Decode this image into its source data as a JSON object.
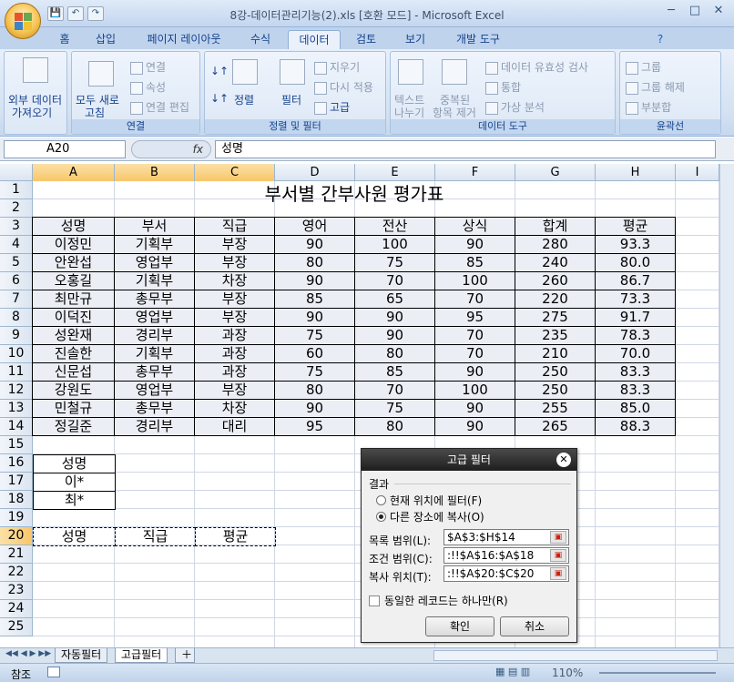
{
  "window": {
    "title": "8강-데이터관리기능(2).xls  [호환 모드] - Microsoft Excel",
    "minimize": "─",
    "maximize": "□",
    "close": "✕"
  },
  "qat": {
    "save": "💾",
    "undo": "↶",
    "redo": "↷"
  },
  "tabs": [
    "홈",
    "삽입",
    "페이지 레이아웃",
    "수식",
    "데이터",
    "검토",
    "보기",
    "개발 도구"
  ],
  "active_tab": "데이터",
  "ribbon": {
    "external": {
      "label1": "외부 데이터",
      "label2": "가져오기"
    },
    "connections": {
      "refresh1": "모두 새로",
      "refresh2": "고침",
      "conn": "연결",
      "props": "속성",
      "edit_links": "연결 편집",
      "group": "연결"
    },
    "sort_filter": {
      "sort": "정렬",
      "filter": "필터",
      "clear": "지우기",
      "reapply": "다시 적용",
      "advanced": "고급",
      "group": "정렬 및 필터"
    },
    "data_tools": {
      "text1": "텍스트",
      "text2": "나누기",
      "dup1": "중복된",
      "dup2": "항목 제거",
      "validation": "데이터 유효성 검사",
      "consolidate": "통합",
      "whatif": "가상 분석",
      "group": "데이터 도구"
    },
    "outline": {
      "group_btn": "그룹",
      "ungroup": "그룹 해제",
      "subtotal": "부분합",
      "group": "윤곽선"
    }
  },
  "formula_bar": {
    "name_box": "A20",
    "fx": "fx",
    "content": "성명"
  },
  "columns": [
    "A",
    "B",
    "C",
    "D",
    "E",
    "F",
    "G",
    "H",
    "I"
  ],
  "rows": [
    "1",
    "2",
    "3",
    "4",
    "5",
    "6",
    "7",
    "8",
    "9",
    "10",
    "11",
    "12",
    "13",
    "14",
    "15",
    "16",
    "17",
    "18",
    "19",
    "20",
    "21",
    "22",
    "23",
    "24",
    "25"
  ],
  "sheet": {
    "title": "부서별 간부사원 평가표",
    "headers": [
      "성명",
      "부서",
      "직급",
      "영어",
      "전산",
      "상식",
      "합계",
      "평균"
    ],
    "rows": [
      [
        "이정민",
        "기획부",
        "부장",
        "90",
        "100",
        "90",
        "280",
        "93.3"
      ],
      [
        "안완섭",
        "영업부",
        "부장",
        "80",
        "75",
        "85",
        "240",
        "80.0"
      ],
      [
        "오홍길",
        "기획부",
        "차장",
        "90",
        "70",
        "100",
        "260",
        "86.7"
      ],
      [
        "최만규",
        "총무부",
        "부장",
        "85",
        "65",
        "70",
        "220",
        "73.3"
      ],
      [
        "이덕진",
        "영업부",
        "부장",
        "90",
        "90",
        "95",
        "275",
        "91.7"
      ],
      [
        "성완재",
        "경리부",
        "과장",
        "75",
        "90",
        "70",
        "235",
        "78.3"
      ],
      [
        "진솔한",
        "기획부",
        "과장",
        "60",
        "80",
        "70",
        "210",
        "70.0"
      ],
      [
        "신문섭",
        "총무부",
        "과장",
        "75",
        "85",
        "90",
        "250",
        "83.3"
      ],
      [
        "강원도",
        "영업부",
        "부장",
        "80",
        "70",
        "100",
        "250",
        "83.3"
      ],
      [
        "민철규",
        "총무부",
        "차장",
        "90",
        "75",
        "90",
        "255",
        "85.0"
      ],
      [
        "정길준",
        "경리부",
        "대리",
        "95",
        "80",
        "90",
        "265",
        "88.3"
      ]
    ],
    "criteria": [
      "성명",
      "이*",
      "최*"
    ],
    "output_headers": [
      "성명",
      "직급",
      "평균"
    ]
  },
  "dialog": {
    "title": "고급 필터",
    "result_label": "결과",
    "opt_inplace": "현재 위치에 필터(F)",
    "opt_copy": "다른 장소에 복사(O)",
    "list_label": "목록 범위(L):",
    "list_value": "$A$3:$H$14",
    "criteria_label": "조건 범위(C):",
    "criteria_value": ":!!$A$16:$A$18",
    "copy_label": "복사 위치(T):",
    "copy_value": ":!!$A$20:$C$20",
    "unique_label": "동일한 레코드는 하나만(R)",
    "ok": "확인",
    "cancel": "취소"
  },
  "sheet_tabs": [
    "자동필터",
    "고급필터"
  ],
  "status": {
    "mode": "참조",
    "zoom": "110%"
  }
}
